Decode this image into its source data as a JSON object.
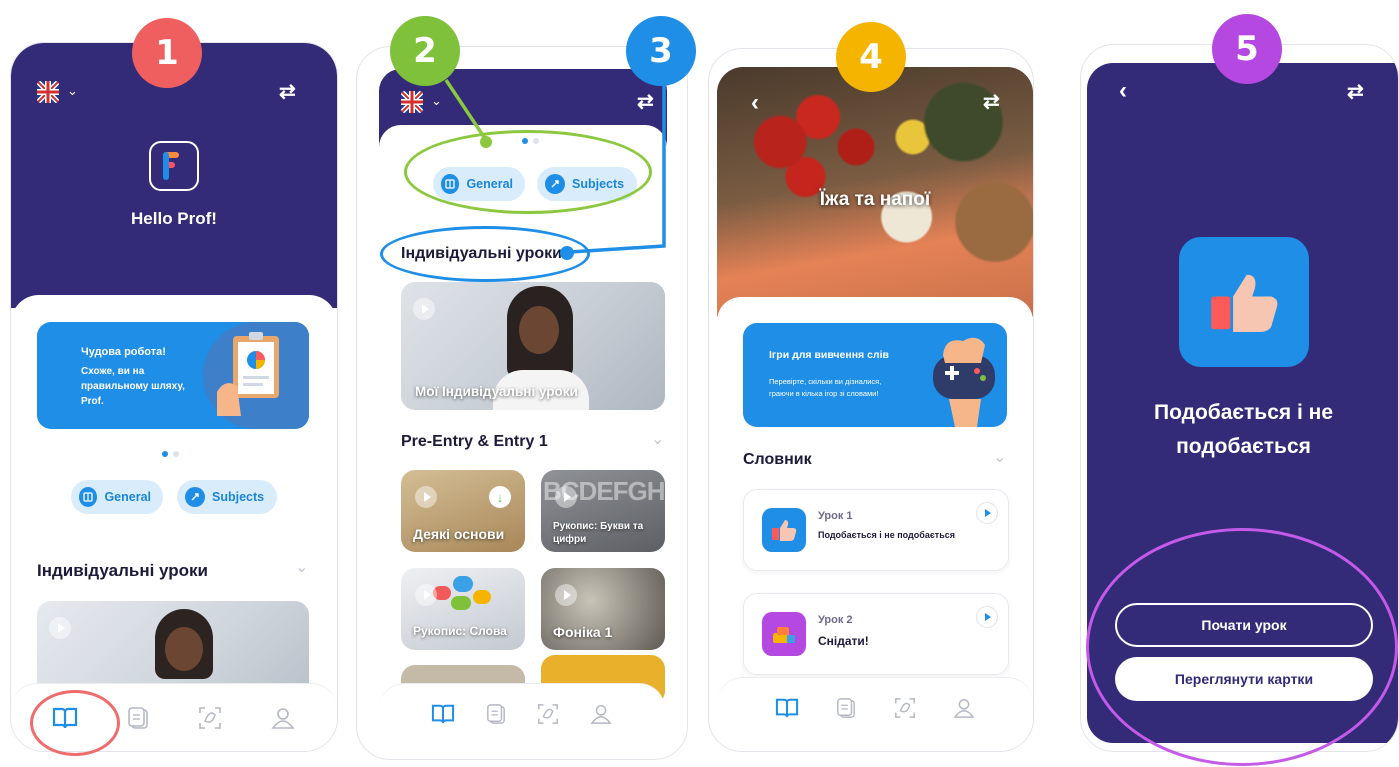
{
  "badges": [
    {
      "num": "1",
      "color": "#ef5f5f"
    },
    {
      "num": "2",
      "color": "#7fc13b"
    },
    {
      "num": "3",
      "color": "#1e8ee6"
    },
    {
      "num": "4",
      "color": "#f4b400"
    },
    {
      "num": "5",
      "color": "#b548e0"
    }
  ],
  "colors": {
    "header": "#332a78",
    "accent_blue": "#1e8ee6",
    "pill_bg": "#d9ecfb",
    "highlight_green": "#8bc83f",
    "highlight_red": "#ef6c6c",
    "highlight_purple": "#c55ae8"
  },
  "screen1": {
    "greeting": "Hello Prof!",
    "banner": {
      "title": "Чудова робота!",
      "line1": "Схоже, ви на",
      "line2": "правильному шляху,",
      "line3": "Prof."
    },
    "pills": [
      "General",
      "Subjects"
    ],
    "section_title": "Індивідуальні уроки"
  },
  "screen2": {
    "pills": [
      "General",
      "Subjects"
    ],
    "section_title": "Індивідуальні уроки",
    "featured_card": "Мої Індивідуальні уроки",
    "section2_title": "Pre-Entry & Entry 1",
    "cards": [
      "Деякі основи",
      "Рукопис: Букви та цифри",
      "Рукопис: Слова",
      "Фоніка 1"
    ]
  },
  "screen3": {
    "title": "Їжа та напої",
    "banner": {
      "title": "Ігри для вивчення слів",
      "line1": "Перевірте, скільки ви дізналися,",
      "line2": "граючи в кілька ігор зі словами!"
    },
    "section_title": "Словник",
    "lessons": [
      {
        "label": "Урок 1",
        "name": "Подобається і не подобається"
      },
      {
        "label": "Урок 2",
        "name": "Снідати!"
      }
    ]
  },
  "screen4": {
    "title_line1": "Подобається і не",
    "title_line2": "подобається",
    "start_button": "Почати урок",
    "cards_button": "Переглянути картки"
  }
}
